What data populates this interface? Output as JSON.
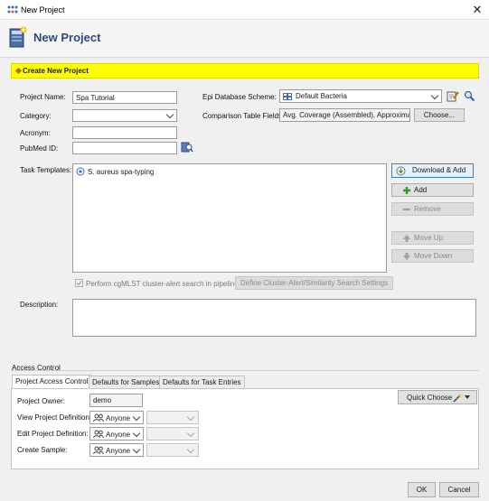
{
  "window": {
    "title": "New Project",
    "close_glyph": "✕"
  },
  "header": {
    "title": "New Project"
  },
  "banner": {
    "text": "Create New Project"
  },
  "form": {
    "project_name_label": "Project Name:",
    "project_name_value": "Spa Tutorial",
    "category_label": "Category:",
    "category_value": "",
    "acronym_label": "Acronym:",
    "acronym_value": "",
    "pubmed_label": "PubMed ID:",
    "pubmed_value": "",
    "epi_label": "Epi Database Scheme:",
    "epi_value": "Default Bacteria",
    "comparison_label": "Comparison Table Fields:",
    "comparison_value": "Avg. Coverage (Assembled), Approximate",
    "choose_label": "Choose...",
    "task_templates_label": "Task Templates:",
    "task_templates": [
      {
        "label": "S. aureus spa-typing"
      }
    ],
    "buttons": {
      "download_add": "Download & Add",
      "add": "Add",
      "remove": "Remove",
      "move_up": "Move Up",
      "move_down": "Move Down"
    },
    "cgmlst_label": "Perform cgMLST cluster-alert search in pipelines",
    "cluster_settings_label": "Define Cluster-Alert/Similarity Search Settings",
    "description_label": "Description:",
    "description_value": ""
  },
  "access": {
    "section_label": "Access Control",
    "tabs": [
      "Project Access Control",
      "Defaults for Samples",
      "Defaults for Task Entries"
    ],
    "owner_label": "Project Owner:",
    "owner_value": "demo",
    "view_label": "View Project Definition:",
    "edit_label": "Edit Project Definition:",
    "create_label": "Create Sample:",
    "anyone": "Anyone",
    "quick_choose": "Quick Choose"
  },
  "footer": {
    "ok": "OK",
    "cancel": "Cancel"
  },
  "colors": {
    "banner": "#ffff00",
    "header_title": "#2c4b7a",
    "add_plus": "#2a9d2a",
    "arrow_gray": "#a0a0a0"
  }
}
